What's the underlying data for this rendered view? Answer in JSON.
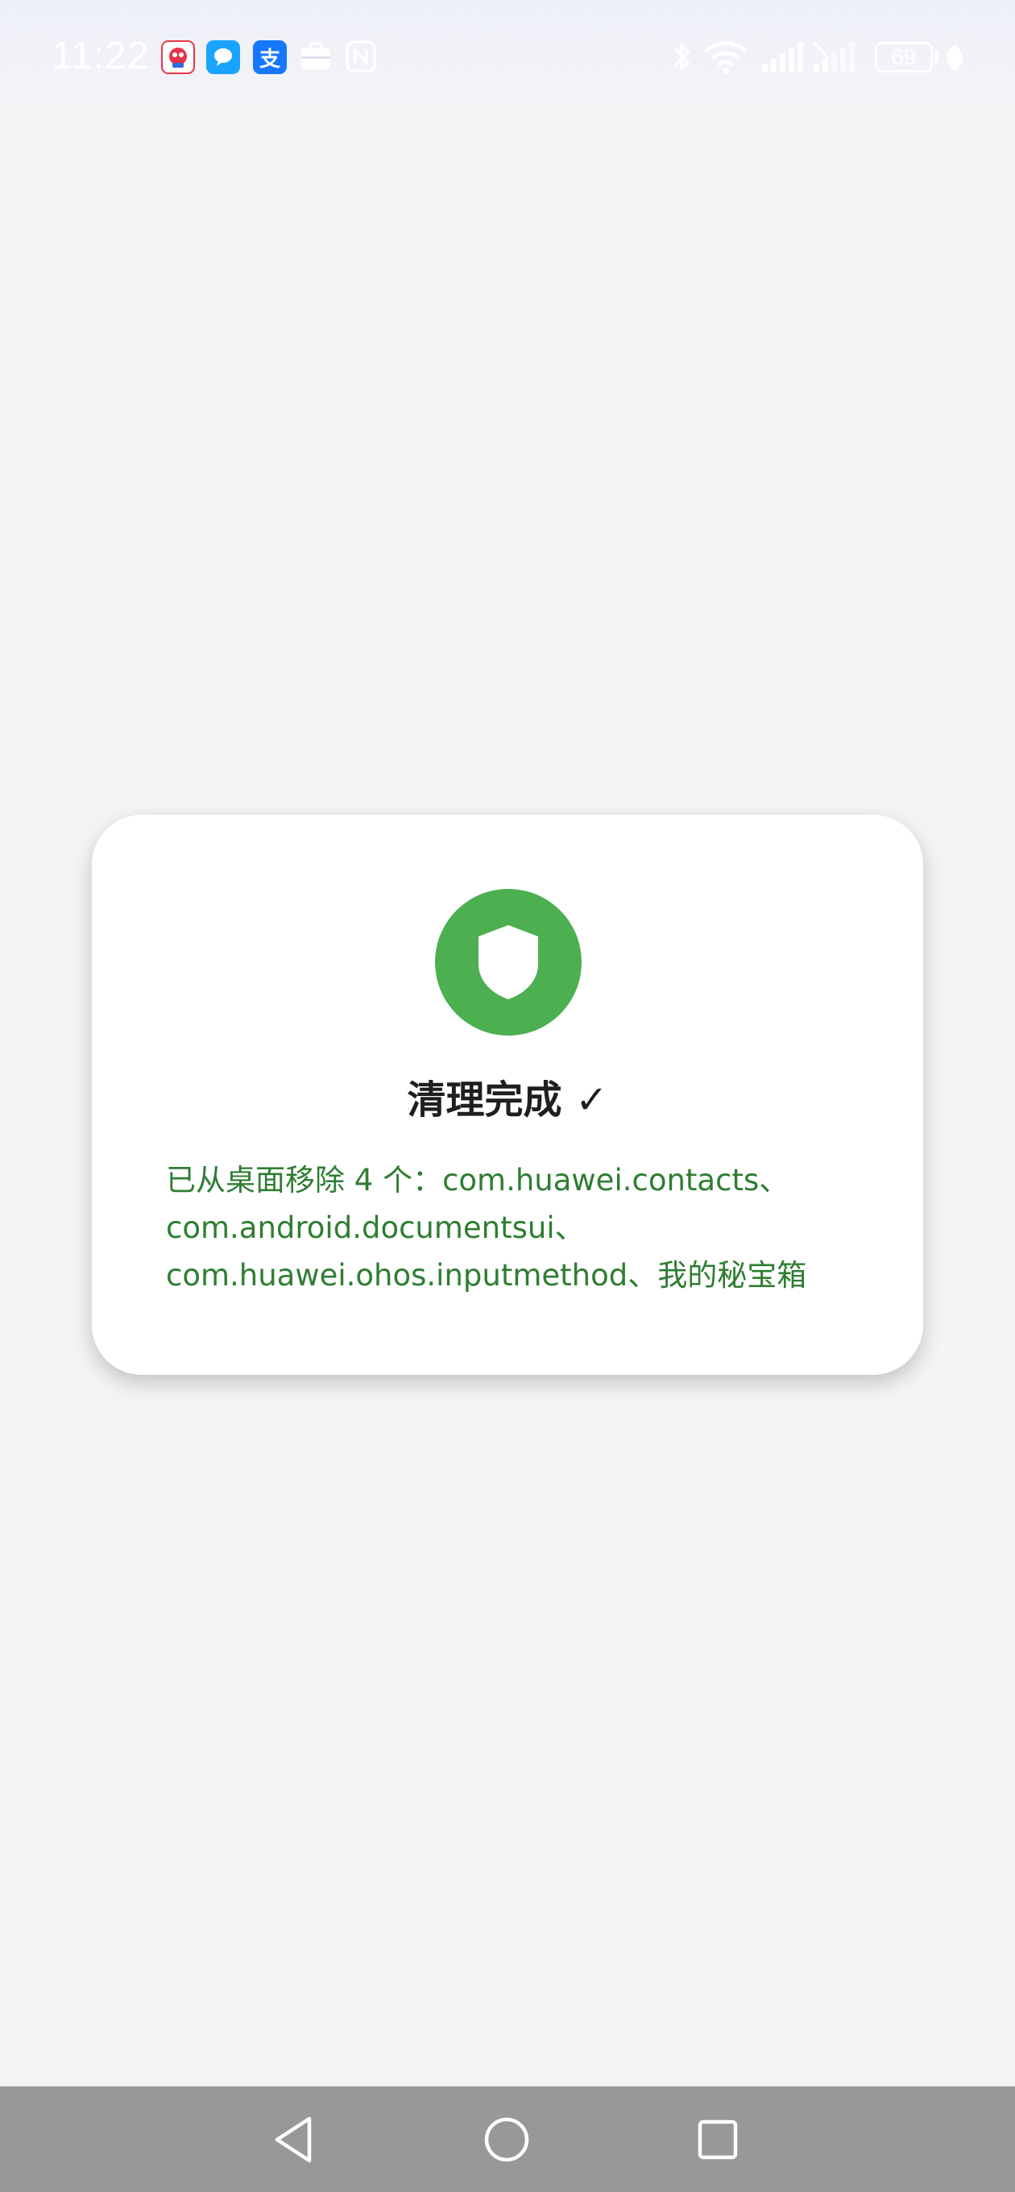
{
  "status_bar": {
    "time": "11:22",
    "notification_icons": [
      {
        "name": "game-app-icon",
        "glyph": "",
        "color": "#e8344a"
      },
      {
        "name": "message-app-icon",
        "glyph": "",
        "color": "#1aa3ff"
      },
      {
        "name": "alipay-app-icon",
        "glyph": "支",
        "color": "#1677ff"
      },
      {
        "name": "briefcase-icon",
        "glyph": "",
        "color": "#ffffff"
      },
      {
        "name": "nfc-icon",
        "glyph": "",
        "color": "#ffffff"
      }
    ],
    "system_icons": [
      "bluetooth-icon",
      "wifi-icon",
      "signal-icon",
      "signal-icon-2"
    ],
    "battery": "69",
    "battery_icon": "battery-icon",
    "charging_icon": "leaf-icon"
  },
  "dialog": {
    "icon": "shield-icon",
    "icon_bg_color": "#4caf50",
    "title": "清理完成 ✓",
    "message_lines": [
      "已从桌面移除 4 个：com.huawei.contacts、",
      "com.android.documentsui、",
      "com.huawei.ohos.inputmethod、我的秘宝箱"
    ],
    "message_color": "#2e7d32"
  },
  "nav_bar": {
    "back_icon": "back-triangle-icon",
    "home_icon": "home-circle-icon",
    "recents_icon": "recents-square-icon"
  }
}
